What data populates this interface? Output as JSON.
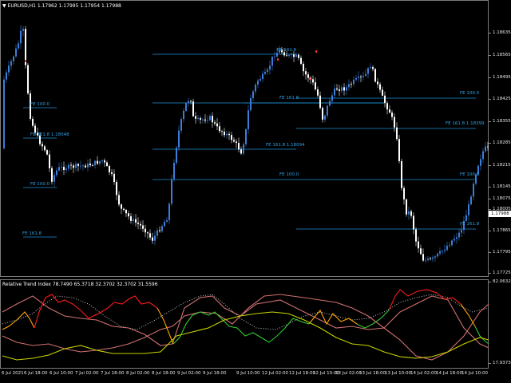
{
  "window": {
    "symbol_header": "EURUSD,H1  1.17962 1.17995 1.17954 1.17988",
    "indicator_header": "Relative Trend Index  78.7490 65.3718 32.3702 32.3702 31.5596"
  },
  "price_axis": {
    "ticks": [
      "1.18635",
      "1.18565",
      "1.18495",
      "1.18425",
      "1.18355",
      "1.18285",
      "1.18215",
      "1.18145",
      "1.18075",
      "1.18005",
      "1.17935",
      "1.17865",
      "1.17795",
      "1.17725"
    ],
    "current_price": "1.17988"
  },
  "indicator_axis": {
    "top": "82.0632",
    "bottom": "17.9373"
  },
  "time_axis": {
    "labels": [
      "6 Jul 2021",
      "6 Jul 18:00",
      "6 Jul 10:00",
      "7 Jul 02:00",
      "7 Jul 18:00",
      "8 Jul 02:00",
      "8 Jul 18:00",
      "9 Jul 02:00",
      "9 Jul 18:00",
      "9 Jul 10:00",
      "12 Jul 02:00",
      "12 Jul 18:00",
      "12 Jul 10:00",
      "13 Jul 02:00",
      "13 Jul 18:00",
      "13 Jul 10:00",
      "14 Jul 02:00",
      "14 Jul 18:00",
      "14 Jul 10:00"
    ]
  },
  "fe_labels": [
    "FE 100.0",
    "FE 161.8 1.18048",
    "FE 100.0",
    "FE 161.8",
    "FE 161.8",
    "FE 161.8 1.18094",
    "FE 100.0",
    "FE 100.0",
    "FE 161.8 1.18399",
    "FE 100.0",
    "FE 161.8"
  ],
  "colors": {
    "bull": "#3d7dd8",
    "bear": "#ffffff",
    "fe_line": "#1e90d6",
    "rti_red": "#ff1a1a",
    "rti_orange": "#ffa500",
    "rti_green": "#32cd32",
    "rti_yellow": "#c8d400",
    "rti_pink": "#d07070",
    "rti_dots": "#d8d8d8"
  }
}
